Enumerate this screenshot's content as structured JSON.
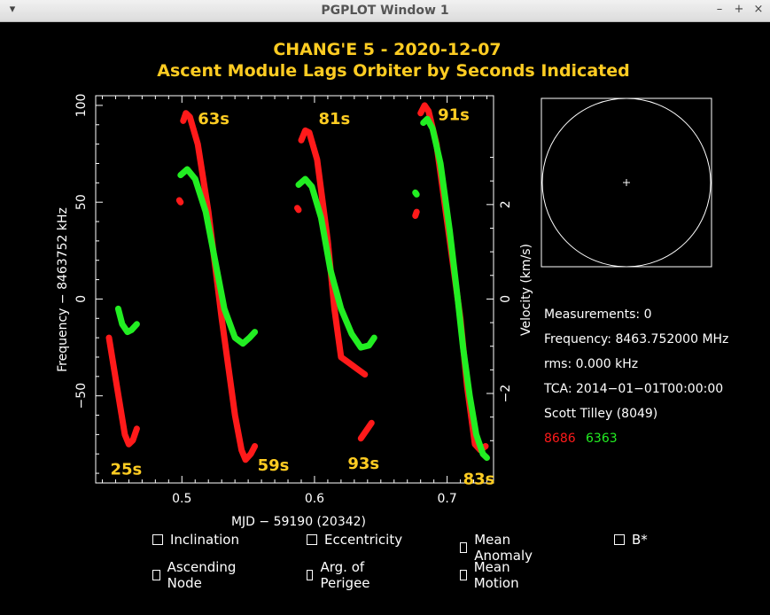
{
  "window": {
    "title": "PGPLOT Window 1"
  },
  "titles": {
    "line1": "CHANG'E 5 - 2020-12-07",
    "line2": "Ascent Module Lags Orbiter by Seconds Indicated"
  },
  "chart_data": {
    "type": "scatter",
    "xlabel": "MJD − 59190 (20342)",
    "ylabel": "Frequency − 8463752 kHz",
    "ylabel_right": "Velocity (km/s)",
    "xlim": [
      0.435,
      0.735
    ],
    "ylim": [
      -95,
      105
    ],
    "xticks": [
      "0.5",
      "0.6",
      "0.7"
    ],
    "yticks": [
      "−50",
      "0",
      "50",
      "100"
    ],
    "yticks_right": [
      "−2",
      "0",
      "2"
    ],
    "colors": {
      "red": "#ff1a1a",
      "green": "#22ee22",
      "label": "#ffcc22"
    },
    "series": [
      {
        "color": "red",
        "segments": [
          [
            [
              0.445,
              -20
            ],
            [
              0.451,
              -45
            ],
            [
              0.457,
              -70
            ],
            [
              0.46,
              -75
            ],
            [
              0.463,
              -73
            ],
            [
              0.466,
              -67
            ]
          ],
          [
            [
              0.498,
              51
            ],
            [
              0.499,
              50
            ]
          ],
          [
            [
              0.501,
              92
            ],
            [
              0.503,
              96
            ],
            [
              0.506,
              94
            ],
            [
              0.512,
              80
            ],
            [
              0.52,
              45
            ],
            [
              0.53,
              -10
            ],
            [
              0.54,
              -60
            ],
            [
              0.545,
              -78
            ],
            [
              0.548,
              -83
            ],
            [
              0.552,
              -80
            ],
            [
              0.555,
              -76
            ]
          ],
          [
            [
              0.587,
              47
            ],
            [
              0.588,
              46
            ]
          ],
          [
            [
              0.59,
              82
            ],
            [
              0.593,
              87
            ],
            [
              0.596,
              86
            ],
            [
              0.602,
              72
            ],
            [
              0.61,
              30
            ],
            [
              0.615,
              -5
            ],
            [
              0.62,
              -30
            ],
            [
              0.626,
              -33
            ],
            [
              0.632,
              -36
            ],
            [
              0.638,
              -39
            ]
          ],
          [
            [
              0.635,
              -72
            ],
            [
              0.639,
              -68
            ],
            [
              0.643,
              -64
            ]
          ],
          [
            [
              0.676,
              43
            ],
            [
              0.677,
              45
            ]
          ],
          [
            [
              0.68,
              96
            ],
            [
              0.683,
              100
            ],
            [
              0.686,
              97
            ],
            [
              0.692,
              80
            ],
            [
              0.7,
              40
            ],
            [
              0.71,
              -10
            ],
            [
              0.715,
              -45
            ],
            [
              0.721,
              -75
            ],
            [
              0.725,
              -78
            ],
            [
              0.729,
              -76
            ]
          ]
        ]
      },
      {
        "color": "green",
        "segments": [
          [
            [
              0.452,
              -5
            ],
            [
              0.455,
              -13
            ],
            [
              0.459,
              -17
            ],
            [
              0.462,
              -16
            ],
            [
              0.466,
              -13
            ]
          ],
          [
            [
              0.499,
              64
            ],
            [
              0.504,
              67
            ],
            [
              0.51,
              62
            ],
            [
              0.518,
              45
            ],
            [
              0.525,
              20
            ],
            [
              0.532,
              -5
            ],
            [
              0.54,
              -20
            ],
            [
              0.546,
              -23
            ],
            [
              0.551,
              -20
            ],
            [
              0.555,
              -17
            ]
          ],
          [
            [
              0.588,
              59
            ],
            [
              0.593,
              62
            ],
            [
              0.598,
              58
            ],
            [
              0.605,
              42
            ],
            [
              0.612,
              15
            ],
            [
              0.62,
              -5
            ],
            [
              0.628,
              -18
            ],
            [
              0.635,
              -25
            ],
            [
              0.641,
              -24
            ],
            [
              0.645,
              -20
            ]
          ],
          [
            [
              0.676,
              55
            ],
            [
              0.677,
              54
            ]
          ],
          [
            [
              0.682,
              91
            ],
            [
              0.685,
              93
            ],
            [
              0.689,
              88
            ],
            [
              0.695,
              70
            ],
            [
              0.702,
              35
            ],
            [
              0.708,
              0
            ],
            [
              0.712,
              -25
            ],
            [
              0.717,
              -50
            ],
            [
              0.722,
              -70
            ],
            [
              0.727,
              -80
            ],
            [
              0.73,
              -82
            ]
          ]
        ]
      }
    ],
    "annotations": [
      {
        "text": "63s",
        "x": 0.512,
        "y": 94
      },
      {
        "text": "81s",
        "x": 0.603,
        "y": 94
      },
      {
        "text": "91s",
        "x": 0.693,
        "y": 96
      },
      {
        "text": "25s",
        "x": 0.446,
        "y": -87
      },
      {
        "text": "59s",
        "x": 0.557,
        "y": -85
      },
      {
        "text": "93s",
        "x": 0.625,
        "y": -84
      },
      {
        "text": "83s",
        "x": 0.712,
        "y": -92
      }
    ]
  },
  "info": {
    "measurements": "Measurements: 0",
    "frequency": "Frequency: 8463.752000 MHz",
    "rms": "rms: 0.000 kHz",
    "tca": "TCA: 2014−01−01T00:00:00",
    "observer": "Scott Tilley (8049)",
    "id_red": "8686",
    "id_green": "6363"
  },
  "checkboxes": {
    "row1": [
      "Inclination",
      "Eccentricity",
      "Mean Anomaly",
      "B*"
    ],
    "row2": [
      "Ascending Node",
      "Arg. of Perigee",
      "Mean Motion"
    ]
  }
}
